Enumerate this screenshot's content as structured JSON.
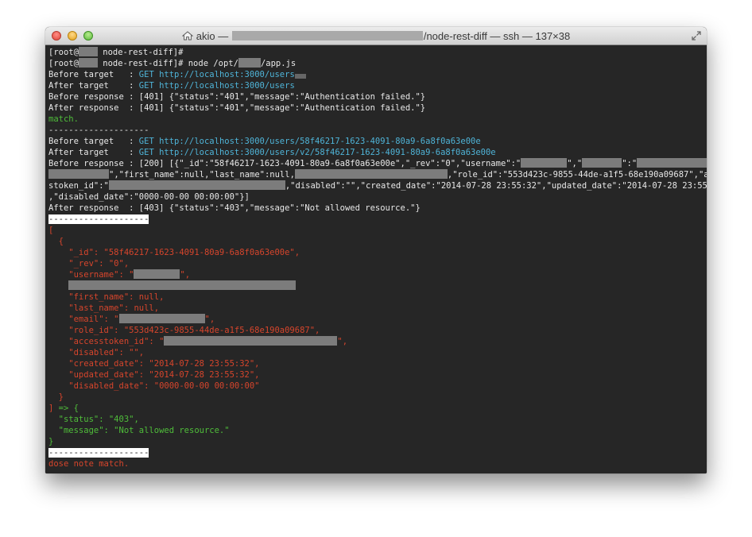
{
  "window": {
    "title_user": "akio — ",
    "title_suffix": "/node-rest-diff — ssh — 137×38"
  },
  "terminal": {
    "prompt1": "[root@",
    "prompt1_rest": " node-rest-diff]#",
    "prompt2": "[root@",
    "prompt2_rest": " node-rest-diff]# node /opt/",
    "prompt2_end": "/app.js",
    "l3_label": "Before target   : ",
    "l3_url": "GET http://localhost:3000/users",
    "l4_label": "After target    : ",
    "l4_url": "GET http://localhost:3000/users",
    "l5": "Before response : [401] {\"status\":\"401\",\"message\":\"Authentication failed.\"}",
    "l6": "After response  : [401] {\"status\":\"401\",\"message\":\"Authentication failed.\"}",
    "l7": "match.",
    "l8": "--------------------",
    "l9_label": "Before target   : ",
    "l9_url": "GET http://localhost:3000/users/58f46217-1623-4091-80a9-6a8f0a63e00e",
    "l10_label": "After target    : ",
    "l10_url": "GET http://localhost:3000/users/v2/58f46217-1623-4091-80a9-6a8f0a63e00e",
    "l11a": "Before response : [200] [{\"_id\":\"58f46217-1623-4091-80a9-6a8f0a63e00e\",\"_rev\":\"0\",\"username\":\"",
    "l11b": "\",\"",
    "l11c": "\":\"",
    "l12a": "\",\"first_name\":null,\"last_name\":null,",
    "l12b": ",\"role_id\":\"553d423c-9855-44de-a1f5-68e190a09687\",\"acces",
    "l13a": "stoken_id\":\"",
    "l13b": ",\"disabled\":\"\",\"created_date\":\"2014-07-28 23:55:32\",\"updated_date\":\"2014-07-28 23:55:32\"",
    "l14": ",\"disabled_date\":\"0000-00-00 00:00:00\"}]",
    "l15": "After response  : [403] {\"status\":\"403\",\"message\":\"Not allowed resource.\"}",
    "sep1": "--------------------",
    "j1": "[",
    "j2": "  {",
    "j3": "    \"_id\": \"58f46217-1623-4091-80a9-6a8f0a63e00e\",",
    "j4": "    \"_rev\": \"0\",",
    "j5a": "    \"username\": \"",
    "j5b": "\",",
    "j7": "    \"first_name\": null,",
    "j8": "    \"last_name\": null,",
    "j9a": "    \"email\": \"",
    "j9b": "\",",
    "j10": "    \"role_id\": \"553d423c-9855-44de-a1f5-68e190a09687\",",
    "j11a": "    \"accesstoken_id\": \"",
    "j11b": "\",",
    "j12": "    \"disabled\": \"\",",
    "j13": "    \"created_date\": \"2014-07-28 23:55:32\",",
    "j14": "    \"updated_date\": \"2014-07-28 23:55:32\",",
    "j15": "    \"disabled_date\": \"0000-00-00 00:00:00\"",
    "j16": "  }",
    "j17a": "]",
    "j17b": " => {",
    "g1": "  \"status\": \"403\",",
    "g2": "  \"message\": \"Not allowed resource.\"",
    "g3": "}",
    "sep2": "--------------------",
    "last": "dose note match."
  }
}
